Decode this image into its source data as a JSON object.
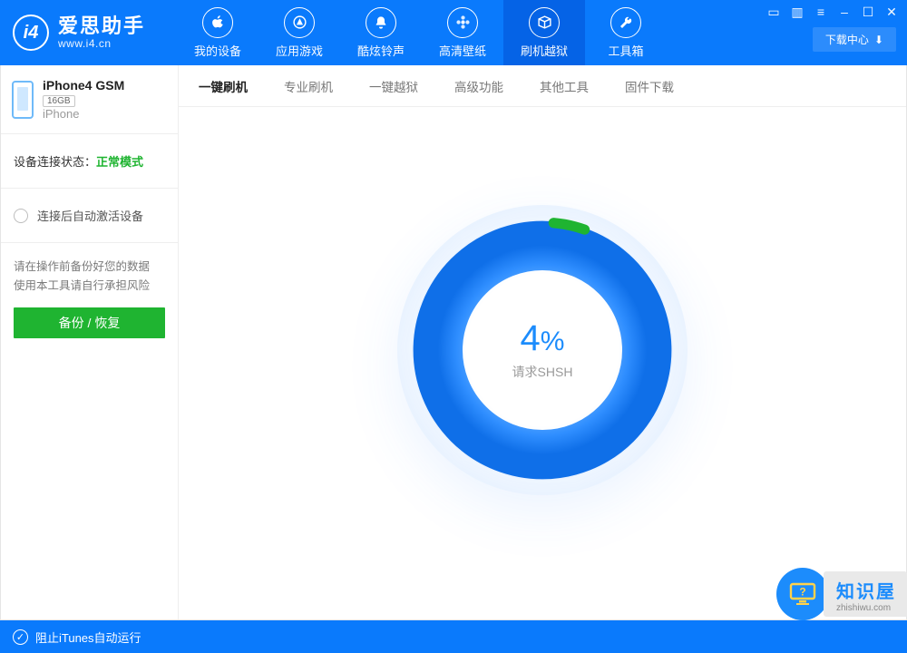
{
  "brand": {
    "logo_text": "i4",
    "title": "爱思助手",
    "url": "www.i4.cn"
  },
  "nav": [
    {
      "label": "我的设备",
      "icon": "apple-icon"
    },
    {
      "label": "应用游戏",
      "icon": "appstore-icon"
    },
    {
      "label": "酷炫铃声",
      "icon": "bell-icon"
    },
    {
      "label": "高清壁纸",
      "icon": "flower-icon"
    },
    {
      "label": "刷机越狱",
      "icon": "box-icon"
    },
    {
      "label": "工具箱",
      "icon": "wrench-icon"
    }
  ],
  "nav_active_index": 4,
  "download_center_label": "下载中心",
  "sidebar": {
    "device_name": "iPhone4 GSM",
    "device_storage": "16GB",
    "device_type": "iPhone",
    "status_label": "设备连接状态：",
    "status_value": "正常模式",
    "auto_activate_label": "连接后自动激活设备",
    "notice_line1": "请在操作前备份好您的数据",
    "notice_line2": "使用本工具请自行承担风险",
    "backup_restore_label": "备份 / 恢复"
  },
  "subtabs": [
    "一键刷机",
    "专业刷机",
    "一键越狱",
    "高级功能",
    "其他工具",
    "固件下载"
  ],
  "subtab_active_index": 0,
  "progress": {
    "percent": 4,
    "percent_unit": "%",
    "status_text": "请求SHSH"
  },
  "footer": {
    "block_itunes_label": "阻止iTunes自动运行"
  },
  "watermark": {
    "title": "知识屋",
    "sub": "zhishiwu.com"
  },
  "colors": {
    "primary": "#0a7afc",
    "accent": "#1c8cfc",
    "success": "#1fb431"
  }
}
